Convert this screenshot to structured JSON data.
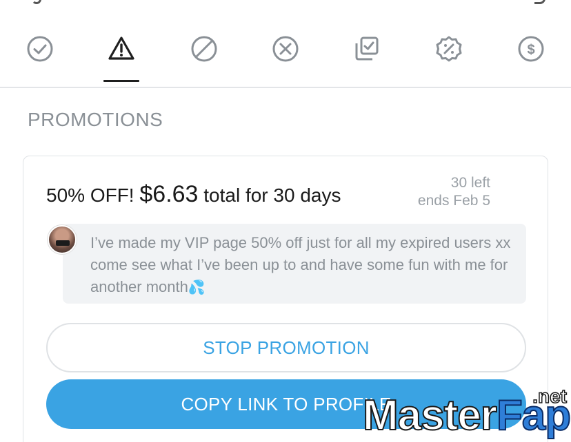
{
  "tabs": [
    {
      "id": "active",
      "icon": "check-circle-icon"
    },
    {
      "id": "warning",
      "icon": "warning-triangle-icon",
      "selected": true
    },
    {
      "id": "blocked",
      "icon": "ban-circle-icon"
    },
    {
      "id": "cancelled",
      "icon": "x-circle-icon"
    },
    {
      "id": "checked-copy",
      "icon": "copy-check-icon"
    },
    {
      "id": "discount",
      "icon": "percent-badge-icon"
    },
    {
      "id": "paid",
      "icon": "dollar-circle-icon"
    }
  ],
  "section": {
    "title": "PROMOTIONS"
  },
  "promotion": {
    "offer_prefix": "50% OFF! ",
    "price": "$6.63",
    "offer_suffix": " total for 30 days",
    "remaining": "30 left",
    "ends": "ends Feb 5",
    "message": "I’ve made my VIP page 50% off just for all my expired users xx come see what I’ve been up to and have some fun with me for another month",
    "message_emoji": "💦"
  },
  "buttons": {
    "stop": "STOP PROMOTION",
    "copy_link": "COPY LINK TO PROFILE"
  },
  "watermark": {
    "brand_master": "Master",
    "brand_fap": "Fap",
    "tld": ".net"
  },
  "colors": {
    "accent": "#3aa3e3",
    "muted": "#8a9096",
    "icon_gray": "#8a9096",
    "icon_active": "#1f1f1f"
  }
}
